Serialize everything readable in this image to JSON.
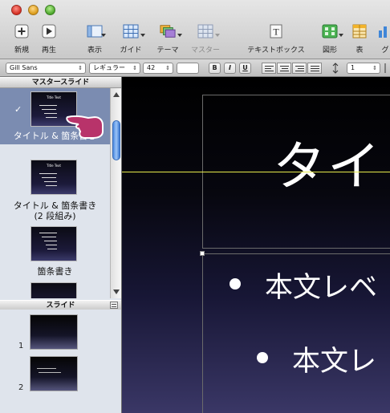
{
  "toolbar": {
    "buttons": [
      {
        "label": "新規",
        "icon": "plus-icon"
      },
      {
        "label": "再生",
        "icon": "play-icon"
      },
      {
        "label": "表示",
        "icon": "view-icon"
      },
      {
        "label": "ガイド",
        "icon": "guide-grid-icon"
      },
      {
        "label": "テーマ",
        "icon": "theme-icon"
      },
      {
        "label": "マスター",
        "icon": "master-icon"
      },
      {
        "label": "テキストボックス",
        "icon": "textbox-icon"
      },
      {
        "label": "図形",
        "icon": "shapes-icon"
      },
      {
        "label": "表",
        "icon": "table-icon"
      },
      {
        "label": "グ",
        "icon": "chart-icon"
      }
    ]
  },
  "format_bar": {
    "font_family": "Gill Sans",
    "font_style": "レギュラー",
    "font_size": "42",
    "bold": "B",
    "italic": "I",
    "underline": "U",
    "line_spacing": "1"
  },
  "sidebar": {
    "master_header": "マスタースライド",
    "slides_header": "スライド",
    "masters": [
      {
        "label": "タイトル & 箇条書き",
        "selected": true,
        "thumb_title": "Title Text"
      },
      {
        "label": "タイトル & 箇条書き\n(2 段組み)",
        "selected": false,
        "thumb_title": "Title Text"
      },
      {
        "label": "箇条書き",
        "selected": false,
        "thumb_title": ""
      }
    ],
    "slides": [
      {
        "number": "1"
      },
      {
        "number": "2"
      }
    ]
  },
  "canvas": {
    "title_text": "タイ",
    "bullets": [
      "本文レベ",
      "本文レ"
    ]
  },
  "colors": {
    "selection": "#7b8cb1",
    "guide": "#e8ec4a",
    "pointer": "#b8336a"
  }
}
